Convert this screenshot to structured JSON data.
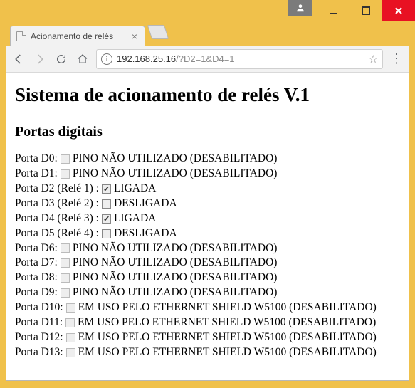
{
  "window": {
    "tab_title": "Acionamento de relés",
    "url_host": "192.168.25.16",
    "url_path": "/?D2=1&D4=1"
  },
  "page": {
    "h1": "Sistema de acionamento de relés V.1",
    "h2": "Portas digitais",
    "ports": [
      {
        "label": "Porta D0:",
        "checked": false,
        "enabled": false,
        "status": "PINO NÃO UTILIZADO (DESABILITADO)"
      },
      {
        "label": "Porta D1:",
        "checked": false,
        "enabled": false,
        "status": "PINO NÃO UTILIZADO (DESABILITADO)"
      },
      {
        "label": "Porta D2 (Relé 1) :",
        "checked": true,
        "enabled": true,
        "status": "LIGADA"
      },
      {
        "label": "Porta D3 (Relé 2) :",
        "checked": false,
        "enabled": true,
        "status": "DESLIGADA"
      },
      {
        "label": "Porta D4 (Relé 3) :",
        "checked": true,
        "enabled": true,
        "status": "LIGADA"
      },
      {
        "label": "Porta D5 (Relé 4) :",
        "checked": false,
        "enabled": true,
        "status": "DESLIGADA"
      },
      {
        "label": "Porta D6:",
        "checked": false,
        "enabled": false,
        "status": "PINO NÃO UTILIZADO (DESABILITADO)"
      },
      {
        "label": "Porta D7:",
        "checked": false,
        "enabled": false,
        "status": "PINO NÃO UTILIZADO (DESABILITADO)"
      },
      {
        "label": "Porta D8:",
        "checked": false,
        "enabled": false,
        "status": "PINO NÃO UTILIZADO (DESABILITADO)"
      },
      {
        "label": "Porta D9:",
        "checked": false,
        "enabled": false,
        "status": "PINO NÃO UTILIZADO (DESABILITADO)"
      },
      {
        "label": "Porta D10:",
        "checked": false,
        "enabled": false,
        "status": "EM USO PELO ETHERNET SHIELD W5100 (DESABILITADO)"
      },
      {
        "label": "Porta D11:",
        "checked": false,
        "enabled": false,
        "status": "EM USO PELO ETHERNET SHIELD W5100 (DESABILITADO)"
      },
      {
        "label": "Porta D12:",
        "checked": false,
        "enabled": false,
        "status": "EM USO PELO ETHERNET SHIELD W5100 (DESABILITADO)"
      },
      {
        "label": "Porta D13:",
        "checked": false,
        "enabled": false,
        "status": "EM USO PELO ETHERNET SHIELD W5100 (DESABILITADO)"
      }
    ]
  }
}
